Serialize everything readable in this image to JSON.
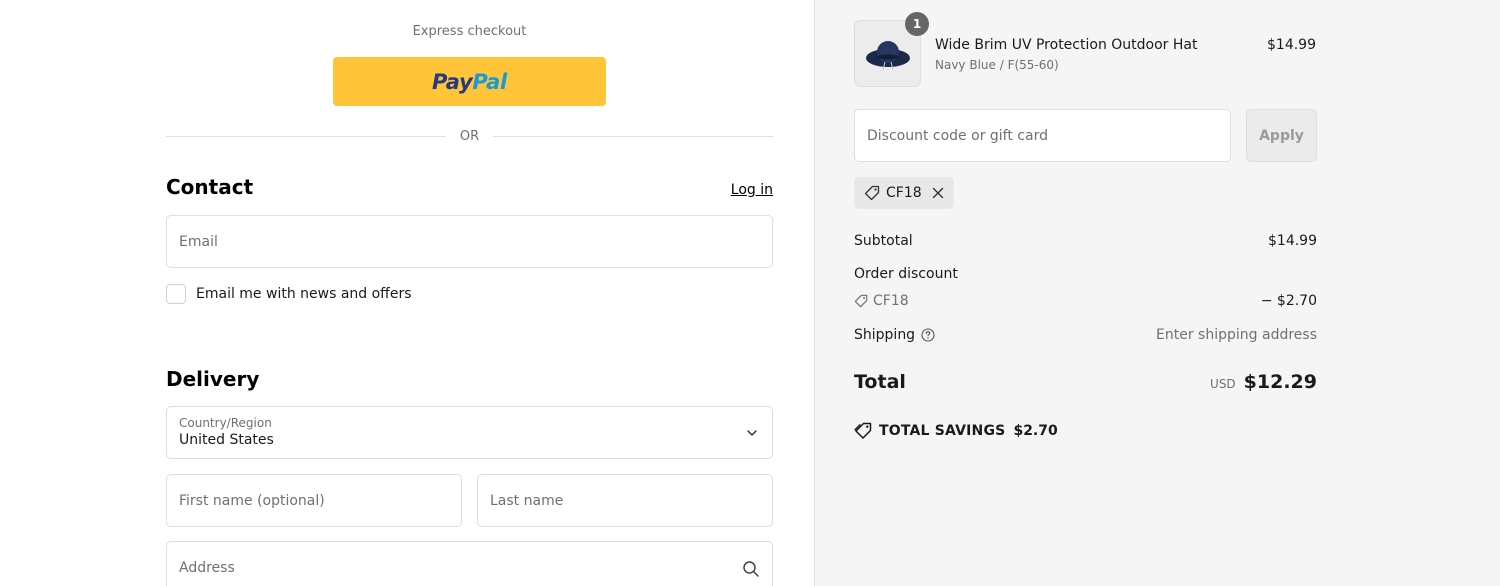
{
  "express": {
    "label": "Express checkout",
    "paypal_pay": "Pay",
    "paypal_pal": "Pal",
    "paypal_color": "#ffc439"
  },
  "divider": {
    "text": "OR"
  },
  "contact": {
    "heading": "Contact",
    "login_link": "Log in",
    "email_placeholder": "Email",
    "newsletter_label": "Email me with news and offers",
    "newsletter_checked": false
  },
  "delivery": {
    "heading": "Delivery",
    "country_label": "Country/Region",
    "country_value": "United States",
    "first_name_placeholder": "First name (optional)",
    "last_name_placeholder": "Last name",
    "address_placeholder": "Address"
  },
  "cart": {
    "item": {
      "quantity": "1",
      "name": "Wide Brim UV Protection Outdoor Hat",
      "variant": "Navy Blue / F(55-60)",
      "price": "$14.99",
      "image_icon": "hat-image"
    }
  },
  "discount": {
    "placeholder": "Discount code or gift card",
    "apply_label": "Apply",
    "applied_code": "CF18"
  },
  "summary": {
    "subtotal_label": "Subtotal",
    "subtotal_value": "$14.99",
    "order_discount_label": "Order discount",
    "discount_code": "CF18",
    "discount_value": "− $2.70",
    "shipping_label": "Shipping",
    "shipping_value": "Enter shipping address",
    "total_label": "Total",
    "currency": "USD",
    "total_value": "$12.29",
    "savings_label": "TOTAL SAVINGS",
    "savings_value": "$2.70"
  }
}
